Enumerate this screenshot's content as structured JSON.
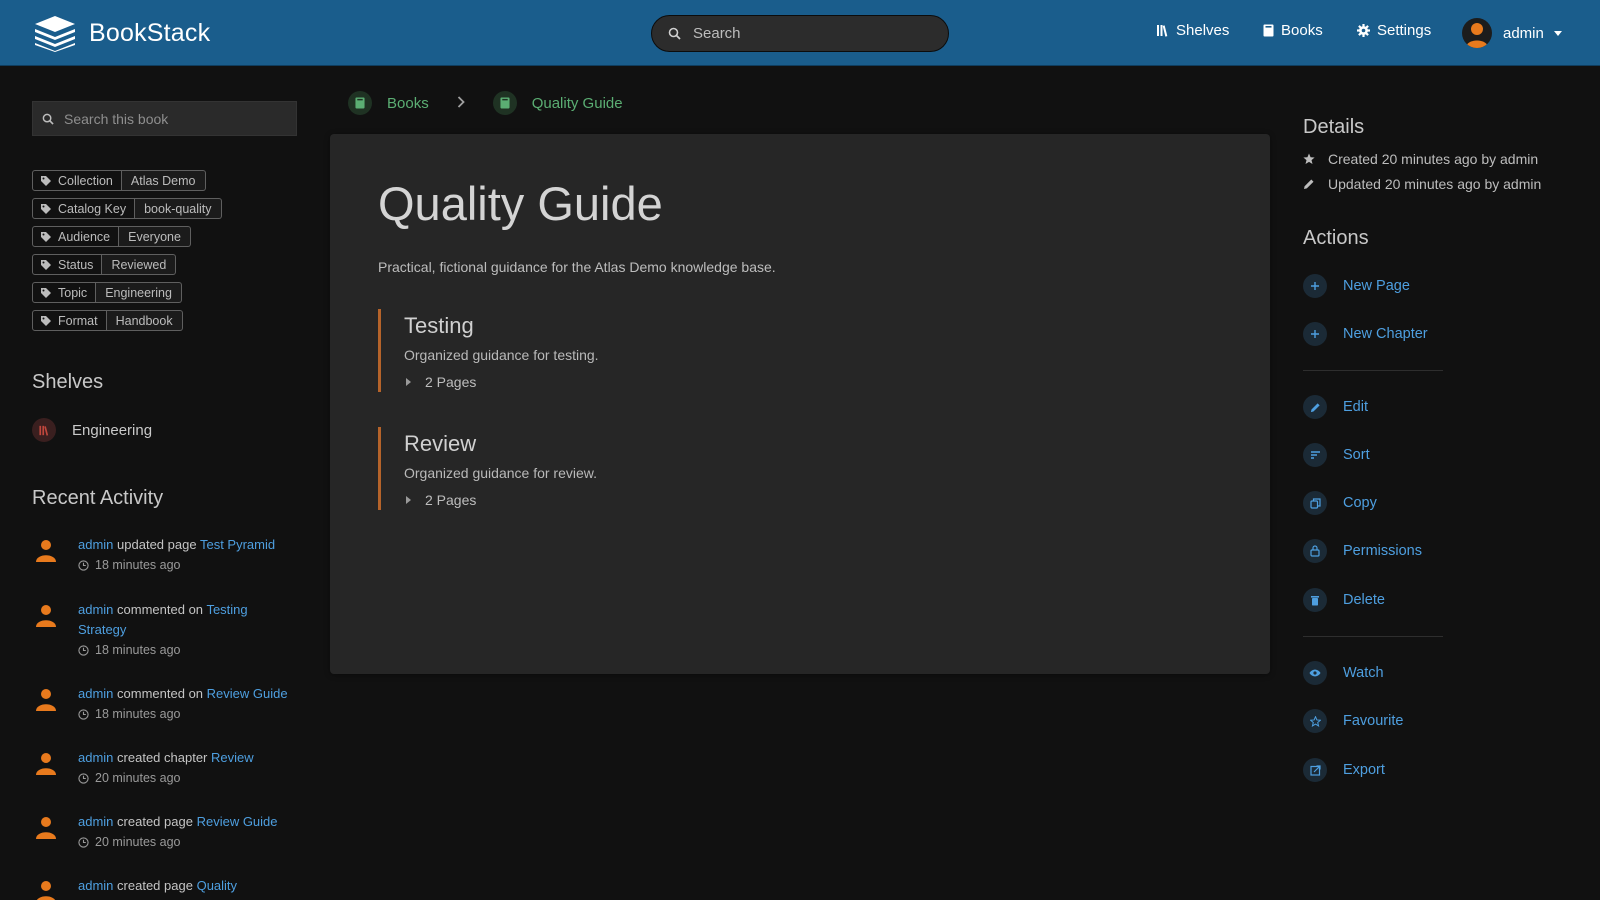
{
  "header": {
    "app_name": "BookStack",
    "search_placeholder": "Search",
    "nav": [
      {
        "label": "Shelves",
        "icon": "shelves-icon"
      },
      {
        "label": "Books",
        "icon": "books-icon"
      },
      {
        "label": "Settings",
        "icon": "gear-icon"
      }
    ],
    "user_name": "admin"
  },
  "sidebar": {
    "book_search_placeholder": "Search this book",
    "tags": [
      {
        "name": "Collection",
        "value": "Atlas Demo"
      },
      {
        "name": "Catalog Key",
        "value": "book-quality"
      },
      {
        "name": "Audience",
        "value": "Everyone"
      },
      {
        "name": "Status",
        "value": "Reviewed"
      },
      {
        "name": "Topic",
        "value": "Engineering"
      },
      {
        "name": "Format",
        "value": "Handbook"
      }
    ],
    "shelves_heading": "Shelves",
    "shelves": [
      {
        "label": "Engineering"
      }
    ],
    "activity_heading": "Recent Activity",
    "activity": [
      {
        "user": "admin",
        "action": "updated page",
        "target": "Test Pyramid",
        "time": "18 minutes ago"
      },
      {
        "user": "admin",
        "action": "commented on",
        "target": "Testing Strategy",
        "time": "18 minutes ago"
      },
      {
        "user": "admin",
        "action": "commented on",
        "target": "Review Guide",
        "time": "18 minutes ago"
      },
      {
        "user": "admin",
        "action": "created chapter",
        "target": "Review",
        "time": "20 minutes ago"
      },
      {
        "user": "admin",
        "action": "created page",
        "target": "Review Guide",
        "time": "20 minutes ago"
      },
      {
        "user": "admin",
        "action": "created page",
        "target": "Quality",
        "time": ""
      }
    ]
  },
  "breadcrumbs": [
    {
      "label": "Books"
    },
    {
      "label": "Quality Guide"
    }
  ],
  "book": {
    "title": "Quality Guide",
    "description": "Practical, fictional guidance for the Atlas Demo knowledge base.",
    "chapters": [
      {
        "title": "Testing",
        "description": "Organized guidance for testing.",
        "pages": "2 Pages"
      },
      {
        "title": "Review",
        "description": "Organized guidance for review.",
        "pages": "2 Pages"
      }
    ]
  },
  "details": {
    "heading": "Details",
    "created": "Created 20 minutes ago by admin",
    "updated": "Updated 20 minutes ago by admin"
  },
  "actions": {
    "heading": "Actions",
    "items": [
      {
        "label": "New Page",
        "icon": "plus-icon"
      },
      {
        "label": "New Chapter",
        "icon": "plus-icon"
      },
      {
        "label": "Edit",
        "icon": "pencil-icon"
      },
      {
        "label": "Sort",
        "icon": "sort-icon"
      },
      {
        "label": "Copy",
        "icon": "copy-icon"
      },
      {
        "label": "Permissions",
        "icon": "lock-icon"
      },
      {
        "label": "Delete",
        "icon": "trash-icon"
      },
      {
        "label": "Watch",
        "icon": "eye-icon"
      },
      {
        "label": "Favourite",
        "icon": "star-icon"
      },
      {
        "label": "Export",
        "icon": "export-icon"
      }
    ]
  },
  "colors": {
    "header_bg": "#1a5d8c",
    "link": "#4e9fe0",
    "book_accent": "#5bae73",
    "chapter_accent": "#b5632a",
    "avatar": "#e87a1d"
  }
}
